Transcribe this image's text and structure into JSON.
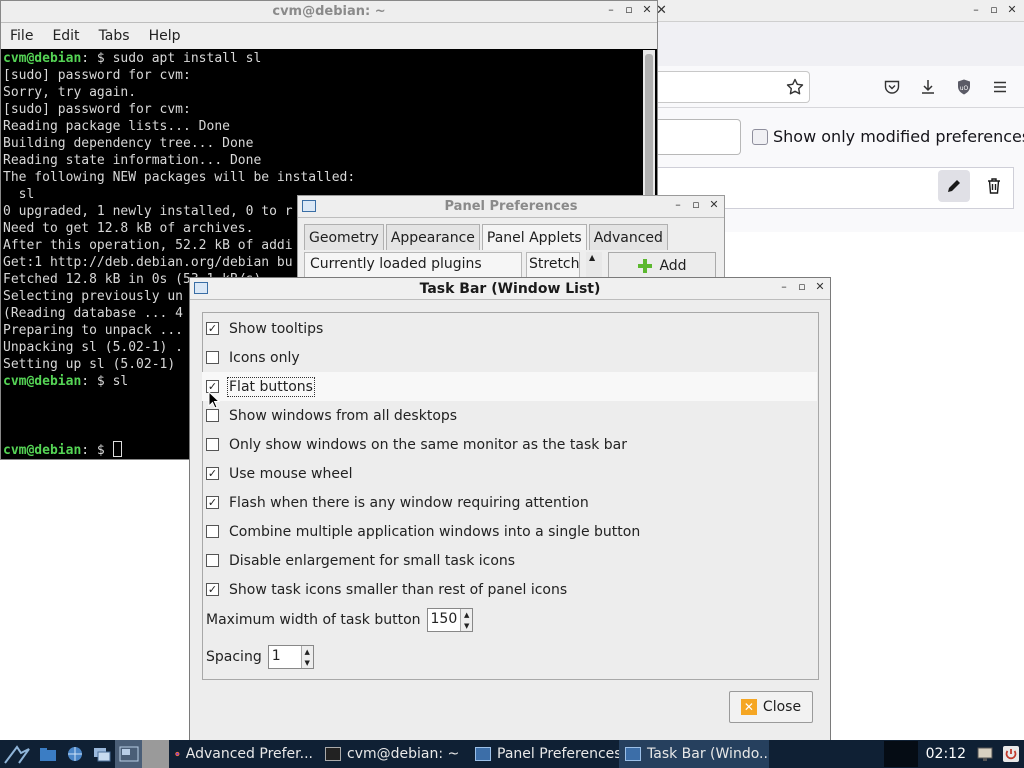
{
  "firefox": {
    "window_buttons": [
      "–",
      "▫",
      "✕"
    ],
    "close_glyph": "✕",
    "show_modified_label": "Show only modified preferences",
    "show_modified_checked": false
  },
  "terminal": {
    "title": "cvm@debian: ~",
    "window_buttons": [
      "–",
      "▫",
      "✕"
    ],
    "menu": [
      "File",
      "Edit",
      "Tabs",
      "Help"
    ],
    "prompt_user": "cvm@debian",
    "prompt_suffix": ": $ ",
    "command1": "sudo apt install sl",
    "output": [
      "[sudo] password for cvm:",
      "Sorry, try again.",
      "[sudo] password for cvm:",
      "Reading package lists... Done",
      "Building dependency tree... Done",
      "Reading state information... Done",
      "The following NEW packages will be installed:",
      "  sl",
      "0 upgraded, 1 newly installed, 0 to r",
      "Need to get 12.8 kB of archives.",
      "After this operation, 52.2 kB of addi",
      "Get:1 http://deb.debian.org/debian bu",
      "Fetched 12.8 kB in 0s (53.1 kB/s)",
      "Selecting previously un",
      "(Reading database ... 4",
      "Preparing to unpack ...",
      "Unpacking sl (5.02-1) .",
      "Setting up sl (5.02-1)"
    ],
    "command2": "sl",
    "prompt_last": "cvm@debian",
    "prompt_last_suffix": ": $ "
  },
  "panel_prefs": {
    "title": "Panel Preferences",
    "window_buttons": [
      "–",
      "▫",
      "✕"
    ],
    "tabs": [
      "Geometry",
      "Appearance",
      "Panel Applets",
      "Advanced"
    ],
    "active_tab": "Panel Applets",
    "col_plugins": "Currently loaded plugins",
    "col_stretch": "Stretch",
    "add_label": "Add"
  },
  "taskbar_dialog": {
    "title": "Task Bar (Window List)",
    "window_buttons": [
      "–",
      "▫",
      "✕"
    ],
    "options": [
      {
        "label": "Show tooltips",
        "checked": true
      },
      {
        "label": "Icons only",
        "checked": false
      },
      {
        "label": "Flat buttons",
        "checked": true
      },
      {
        "label": "Show windows from all desktops",
        "checked": false
      },
      {
        "label": "Only show windows on the same monitor as the task bar",
        "checked": false
      },
      {
        "label": "Use mouse wheel",
        "checked": true
      },
      {
        "label": "Flash when there is any window requiring attention",
        "checked": true
      },
      {
        "label": "Combine multiple application windows into a single button",
        "checked": false
      },
      {
        "label": "Disable enlargement for small task icons",
        "checked": false
      },
      {
        "label": "Show task icons smaller than rest of panel icons",
        "checked": true
      }
    ],
    "max_width_label": "Maximum width of task button",
    "max_width_value": "150",
    "spacing_label": "Spacing",
    "spacing_value": "1",
    "close_label": "Close"
  },
  "taskbar": {
    "tasks": [
      {
        "label": "Advanced Prefer...",
        "icon": "firefox-icon"
      },
      {
        "label": "cvm@debian: ~",
        "icon": "terminal-icon"
      },
      {
        "label": "Panel Preferences",
        "icon": "window-icon"
      },
      {
        "label": "Task Bar (Windo...",
        "icon": "window-icon"
      }
    ],
    "clock": "02:12"
  },
  "colors": {
    "terminal_prompt": "#55d455",
    "taskbar_bg": "#0f2034",
    "checkbox_focus": "#333333"
  }
}
